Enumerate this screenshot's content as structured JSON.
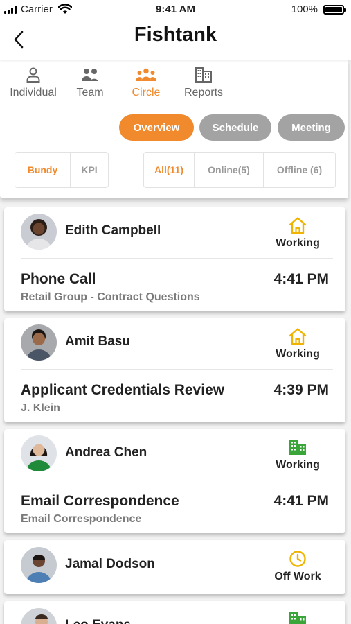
{
  "statusbar": {
    "carrier": "Carrier",
    "time": "9:41 AM",
    "battery": "100%"
  },
  "header": {
    "title": "Fishtank"
  },
  "tabs": [
    {
      "label": "Individual",
      "icon": "person-icon"
    },
    {
      "label": "Team",
      "icon": "team-icon"
    },
    {
      "label": "Circle",
      "icon": "circle-icon"
    },
    {
      "label": "Reports",
      "icon": "reports-icon"
    }
  ],
  "active_tab": "Circle",
  "views": [
    {
      "label": "Overview",
      "active": true
    },
    {
      "label": "Schedule",
      "active": false
    },
    {
      "label": "Meeting",
      "active": false
    }
  ],
  "mode_filter": [
    {
      "label": "Bundy",
      "active": true
    },
    {
      "label": "KPI",
      "active": false
    }
  ],
  "presence_filter": [
    {
      "label": "All(11)",
      "active": true
    },
    {
      "label": "Online(5)",
      "active": false
    },
    {
      "label": "Offline (6)",
      "active": false
    }
  ],
  "colors": {
    "accent": "#f08a2c",
    "home": "#f0b400",
    "office": "#3aa63a",
    "clock": "#f0b400",
    "pill_inactive": "#a3a3a3"
  },
  "members": [
    {
      "name": "Edith Campbell",
      "status": "Working",
      "status_icon": "home-icon",
      "activity": "Phone Call",
      "time": "4:41 PM",
      "detail": "Retail Group - Contract Questions"
    },
    {
      "name": "Amit Basu",
      "status": "Working",
      "status_icon": "home-icon",
      "activity": "Applicant Credentials Review",
      "time": "4:39 PM",
      "detail": "J. Klein"
    },
    {
      "name": "Andrea Chen",
      "status": "Working",
      "status_icon": "office-building-icon",
      "activity": "Email Correspondence",
      "time": "4:41 PM",
      "detail": "Email Correspondence"
    },
    {
      "name": "Jamal Dodson",
      "status": "Off Work",
      "status_icon": "clock-icon"
    },
    {
      "name": "Leo Evans",
      "status_icon": "office-building-icon"
    }
  ]
}
